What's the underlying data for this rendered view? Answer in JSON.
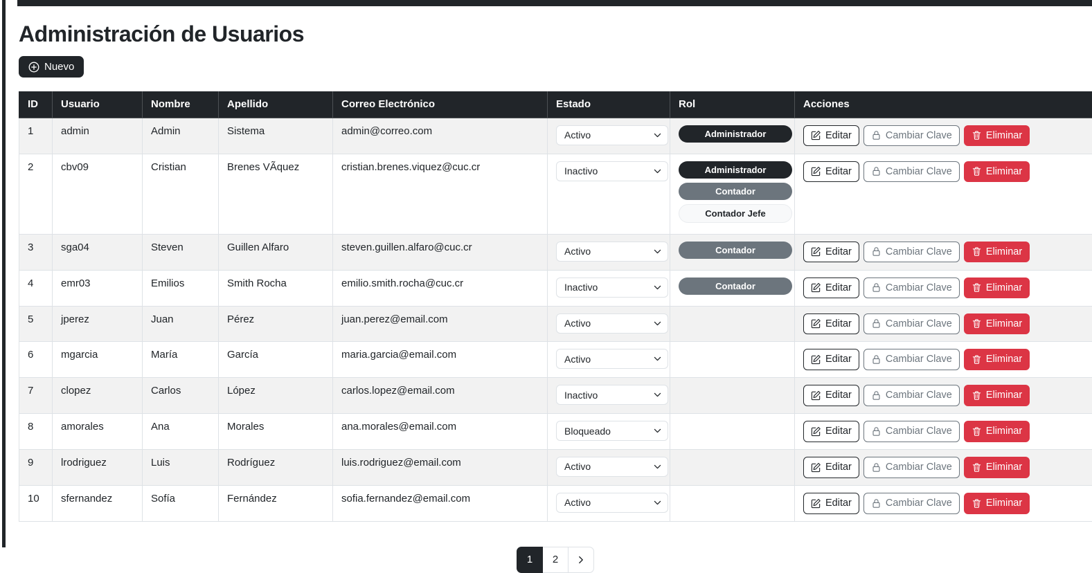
{
  "page": {
    "title": "Administración de Usuarios",
    "new_button_label": "Nuevo",
    "new_button_icon": "plus-circle"
  },
  "colors": {
    "dark": "#212529",
    "secondary": "#6c757d",
    "danger": "#dc3545",
    "stripe": "#f2f2f2",
    "table_border": "#dee2e6"
  },
  "table": {
    "columns": [
      "ID",
      "Usuario",
      "Nombre",
      "Apellido",
      "Correo Electrónico",
      "Estado",
      "Rol",
      "Acciones"
    ],
    "actions": {
      "edit": "Editar",
      "change_password": "Cambiar Clave",
      "delete": "Eliminar"
    },
    "rows": [
      {
        "id": "1",
        "usuario": "admin",
        "nombre": "Admin",
        "apellido": "Sistema",
        "correo": "admin@correo.com",
        "estado": "Activo",
        "roles": [
          {
            "label": "Administrador",
            "variant": "dark"
          }
        ]
      },
      {
        "id": "2",
        "usuario": "cbv09",
        "nombre": "Cristian",
        "apellido": "Brenes VÃquez",
        "correo": "cristian.brenes.viquez@cuc.cr",
        "estado": "Inactivo",
        "roles": [
          {
            "label": "Administrador",
            "variant": "dark"
          },
          {
            "label": "Contador",
            "variant": "secondary"
          },
          {
            "label": "Contador Jefe",
            "variant": "light"
          }
        ]
      },
      {
        "id": "3",
        "usuario": "sga04",
        "nombre": "Steven",
        "apellido": "Guillen Alfaro",
        "correo": "steven.guillen.alfaro@cuc.cr",
        "estado": "Activo",
        "roles": [
          {
            "label": "Contador",
            "variant": "secondary"
          }
        ]
      },
      {
        "id": "4",
        "usuario": "emr03",
        "nombre": "Emilios",
        "apellido": "Smith Rocha",
        "correo": "emilio.smith.rocha@cuc.cr",
        "estado": "Inactivo",
        "roles": [
          {
            "label": "Contador",
            "variant": "secondary"
          }
        ]
      },
      {
        "id": "5",
        "usuario": "jperez",
        "nombre": "Juan",
        "apellido": "Pérez",
        "correo": "juan.perez@email.com",
        "estado": "Activo",
        "roles": []
      },
      {
        "id": "6",
        "usuario": "mgarcia",
        "nombre": "María",
        "apellido": "García",
        "correo": "maria.garcia@email.com",
        "estado": "Activo",
        "roles": []
      },
      {
        "id": "7",
        "usuario": "clopez",
        "nombre": "Carlos",
        "apellido": "López",
        "correo": "carlos.lopez@email.com",
        "estado": "Inactivo",
        "roles": []
      },
      {
        "id": "8",
        "usuario": "amorales",
        "nombre": "Ana",
        "apellido": "Morales",
        "correo": "ana.morales@email.com",
        "estado": "Bloqueado",
        "roles": []
      },
      {
        "id": "9",
        "usuario": "lrodriguez",
        "nombre": "Luis",
        "apellido": "Rodríguez",
        "correo": "luis.rodriguez@email.com",
        "estado": "Activo",
        "roles": []
      },
      {
        "id": "10",
        "usuario": "sfernandez",
        "nombre": "Sofía",
        "apellido": "Fernández",
        "correo": "sofia.fernandez@email.com",
        "estado": "Activo",
        "roles": []
      }
    ]
  },
  "pagination": {
    "pages": [
      "1",
      "2"
    ],
    "active_page": "1",
    "next_icon": "chevron-right"
  }
}
